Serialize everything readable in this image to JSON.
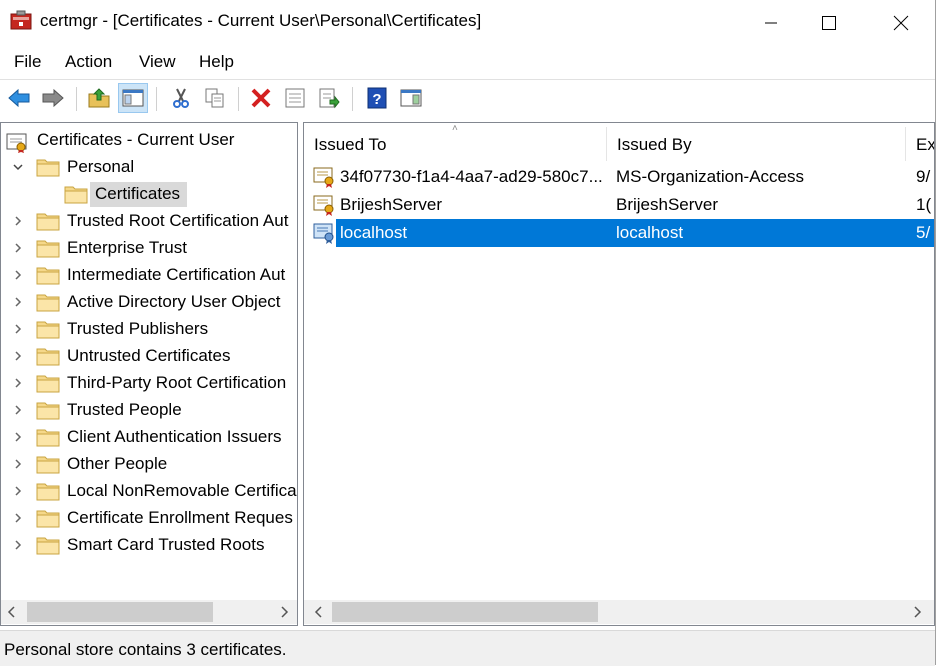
{
  "window": {
    "title": "certmgr - [Certificates - Current User\\Personal\\Certificates]"
  },
  "menu": {
    "file": "File",
    "action": "Action",
    "view": "View",
    "help": "Help"
  },
  "toolbar": {
    "icons": [
      "back-arrow-icon",
      "forward-arrow-icon",
      "up-folder-icon",
      "show-hide-console-tree-icon",
      "cut-icon",
      "copy-icon",
      "delete-icon",
      "properties-icon",
      "export-list-icon",
      "help-icon",
      "action-pane-icon"
    ]
  },
  "tree": {
    "root": "Certificates - Current User",
    "personal": "Personal",
    "certificates": "Certificates",
    "items": [
      "Trusted Root Certification Aut",
      "Enterprise Trust",
      "Intermediate Certification Aut",
      "Active Directory User Object",
      "Trusted Publishers",
      "Untrusted Certificates",
      "Third-Party Root Certification",
      "Trusted People",
      "Client Authentication Issuers",
      "Other People",
      "Local NonRemovable Certifica",
      "Certificate Enrollment Reques",
      "Smart Card Trusted Roots"
    ]
  },
  "list": {
    "columns": {
      "issued_to": "Issued To",
      "issued_by": "Issued By",
      "expiration": "Ex"
    },
    "rows": [
      {
        "issued_to": "34f07730-f1a4-4aa7-ad29-580c7...",
        "issued_by": "MS-Organization-Access",
        "expiration": "9/"
      },
      {
        "issued_to": "BrijeshServer",
        "issued_by": "BrijeshServer",
        "expiration": "1("
      },
      {
        "issued_to": "localhost",
        "issued_by": "localhost",
        "expiration": "5/"
      }
    ]
  },
  "status": {
    "text": "Personal store contains 3 certificates."
  },
  "colors": {
    "selection": "#0078d7",
    "tree_selection": "#d9d9d9",
    "folder": "#f5d88a"
  }
}
